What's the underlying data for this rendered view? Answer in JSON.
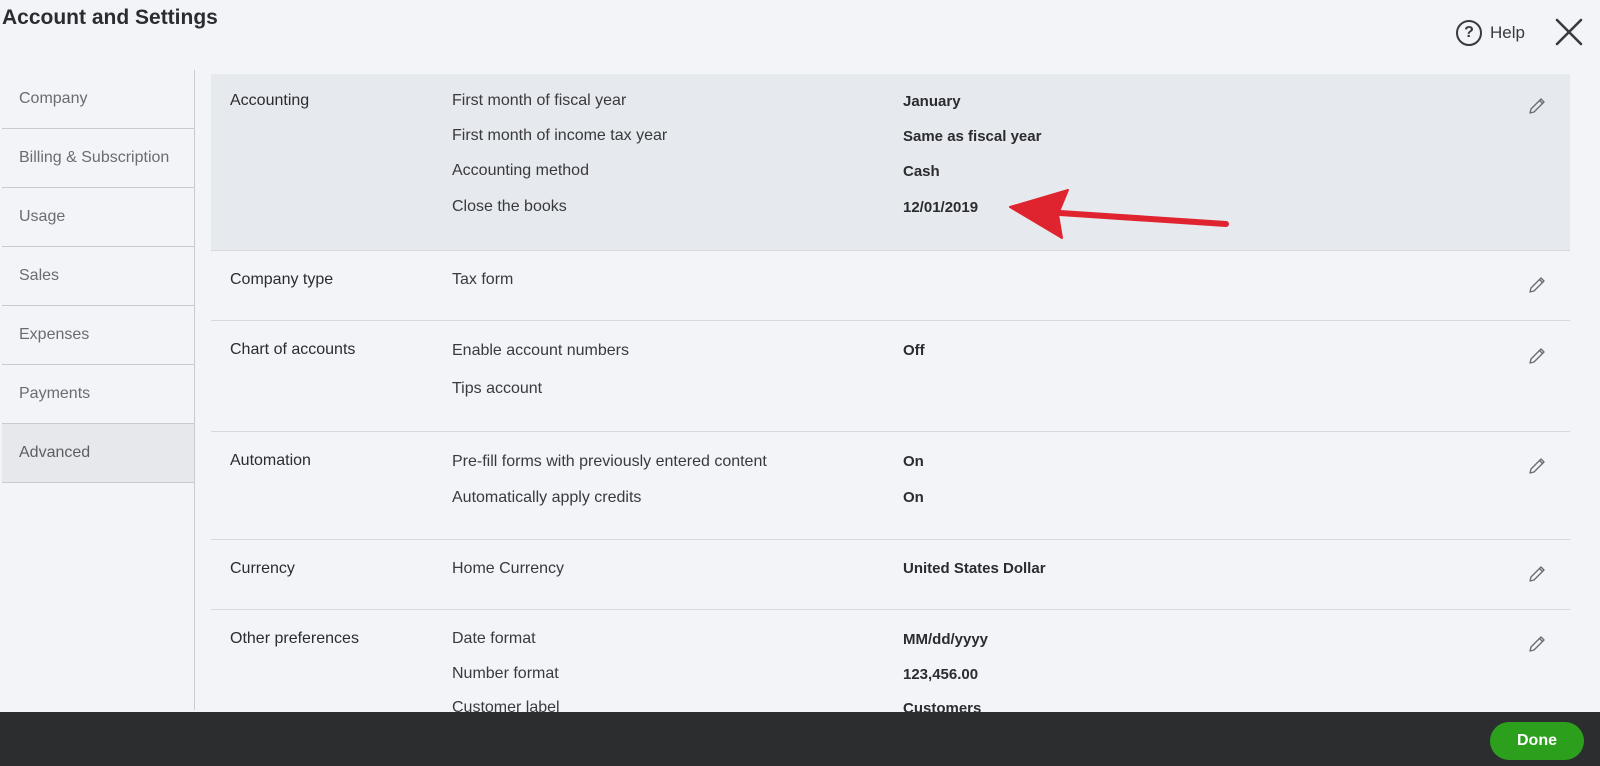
{
  "header": {
    "title": "Account and Settings",
    "help_label": "Help",
    "help_icon": "question-circle-icon",
    "close_icon": "close-x-icon"
  },
  "sidebar": {
    "items": [
      {
        "label": "Company"
      },
      {
        "label": "Billing & Subscription"
      },
      {
        "label": "Usage"
      },
      {
        "label": "Sales"
      },
      {
        "label": "Expenses"
      },
      {
        "label": "Payments"
      },
      {
        "label": "Advanced",
        "active": true
      }
    ]
  },
  "sections": {
    "accounting": {
      "title": "Accounting",
      "rows": [
        {
          "label": "First month of fiscal year",
          "value": "January"
        },
        {
          "label": "First month of income tax year",
          "value": "Same as fiscal year"
        },
        {
          "label": "Accounting method",
          "value": "Cash"
        },
        {
          "label": "Close the books",
          "value": "12/01/2019"
        }
      ]
    },
    "company_type": {
      "title": "Company type",
      "rows": [
        {
          "label": "Tax form",
          "value": ""
        }
      ]
    },
    "chart_of_accounts": {
      "title": "Chart of accounts",
      "rows": [
        {
          "label": "Enable account numbers",
          "value": "Off"
        },
        {
          "label": "Tips account",
          "value": ""
        }
      ]
    },
    "automation": {
      "title": "Automation",
      "rows": [
        {
          "label": "Pre-fill forms with previously entered content",
          "value": "On"
        },
        {
          "label": "Automatically apply credits",
          "value": "On"
        }
      ]
    },
    "currency": {
      "title": "Currency",
      "rows": [
        {
          "label": "Home Currency",
          "value": "United States Dollar"
        }
      ]
    },
    "other_preferences": {
      "title": "Other preferences",
      "rows": [
        {
          "label": "Date format",
          "value": "MM/dd/yyyy"
        },
        {
          "label": "Number format",
          "value": "123,456.00"
        },
        {
          "label": "Customer label",
          "value": "Customers"
        }
      ]
    }
  },
  "annotation": {
    "arrow_color": "#e0242f"
  },
  "footer": {
    "done_label": "Done",
    "done_color": "#2ca01c"
  }
}
